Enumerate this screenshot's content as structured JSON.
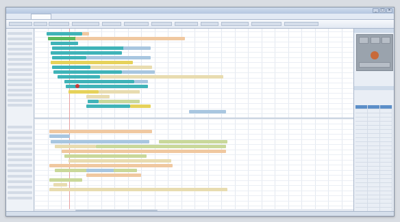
{
  "window": {
    "title": "",
    "controls": [
      "_",
      "□",
      "×"
    ]
  },
  "tabs": [
    "",
    "",
    "",
    "",
    "",
    "",
    "",
    ""
  ],
  "ribbon": {
    "buttons": [
      "",
      "",
      "",
      "",
      "",
      "",
      "",
      "",
      "",
      "",
      "",
      ""
    ]
  },
  "sidebar": {
    "items": [
      "",
      "",
      "",
      "",
      "",
      "",
      "",
      "",
      "",
      "",
      "",
      "",
      "",
      "",
      "",
      "",
      "",
      "",
      "",
      "",
      "",
      "",
      "",
      "",
      "",
      "",
      "",
      "",
      ""
    ]
  },
  "gantt": {
    "bar_colors": {
      "teal": "#3fb3b8",
      "green": "#5cb85c",
      "yellow": "#e6d25a",
      "peach": "#f0c8a0",
      "lightblue": "#a8c6e0",
      "olive": "#c9d89a",
      "tan": "#e8dcb0"
    }
  },
  "right_panel": {
    "header_top": "",
    "header_bottom": "",
    "table_headers": [
      "",
      "",
      ""
    ]
  },
  "status": {
    "text": ""
  },
  "colors": {
    "accent": "#5c8fc8",
    "today_line": "#e8a0a0",
    "milestone": "#c83a3a"
  }
}
